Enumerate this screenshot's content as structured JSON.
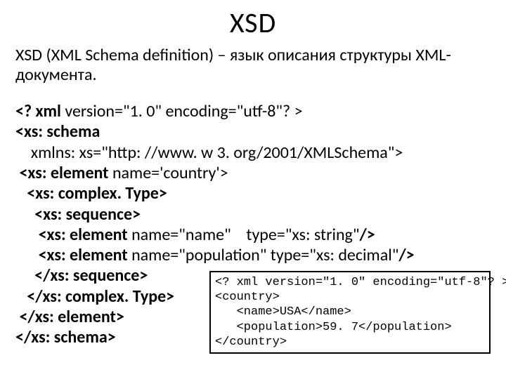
{
  "title": "XSD",
  "description": "XSD (XML Schema definition) – язык описания структуры XML-документа.",
  "xsd": {
    "l1_b": "<? xml",
    "l1_r": " version=\"1. 0\" encoding=\"utf-8\"? >",
    "l2_b": "<xs: schema",
    "l3": "    xmlns: xs=\"http: //www. w 3. org/2001/XMLSchema\">",
    "l4_a": " ",
    "l4_b": "<xs: element",
    "l4_r": " name='country'>",
    "l5_a": "   ",
    "l5_b": "<xs: complex. Type>",
    "l6_a": "     ",
    "l6_b": "<xs: sequence>",
    "l7_a": "      ",
    "l7_b": "<xs: element",
    "l7_r": " name=\"name\"    type=\"xs: string\"",
    "l7_e": "/>",
    "l8_a": "      ",
    "l8_b": "<xs: element",
    "l8_r": " name=\"population\" type=\"xs: decimal\"",
    "l8_e": "/>",
    "l9_a": "     ",
    "l9_b": "</xs: sequence>",
    "l10_a": "   ",
    "l10_b": "</xs: complex. Type>",
    "l11_a": " ",
    "l11_b": "</xs: element>",
    "l12_b": "</xs: schema>"
  },
  "xmlbox": "<? xml version=\"1. 0\" encoding=\"utf-8\"? >\n<country>\n   <name>USA</name>\n   <population>59. 7</population>\n</country>"
}
